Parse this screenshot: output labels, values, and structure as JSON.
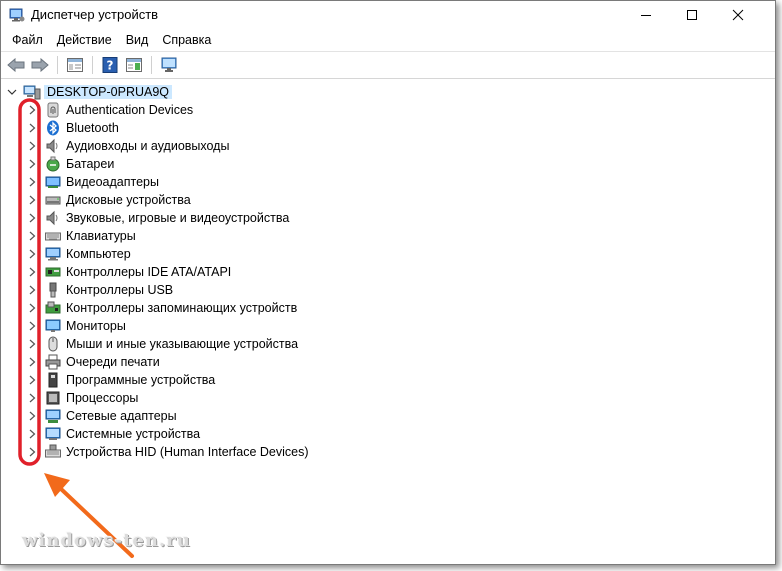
{
  "window": {
    "title": "Диспетчер устройств"
  },
  "menu": {
    "file": "Файл",
    "action": "Действие",
    "view": "Вид",
    "help": "Справка"
  },
  "tree": {
    "root": "DESKTOP-0PRUA9Q",
    "items": [
      {
        "label": "Authentication Devices",
        "icon": "fingerprint-icon"
      },
      {
        "label": "Bluetooth",
        "icon": "bluetooth-icon"
      },
      {
        "label": "Аудиовходы и аудиовыходы",
        "icon": "speaker-icon"
      },
      {
        "label": "Батареи",
        "icon": "battery-icon"
      },
      {
        "label": "Видеоадаптеры",
        "icon": "display-adapter-icon"
      },
      {
        "label": "Дисковые устройства",
        "icon": "disk-drive-icon"
      },
      {
        "label": "Звуковые, игровые и видеоустройства",
        "icon": "speaker-icon"
      },
      {
        "label": "Клавиатуры",
        "icon": "keyboard-icon"
      },
      {
        "label": "Компьютер",
        "icon": "computer-icon"
      },
      {
        "label": "Контроллеры IDE ATA/ATAPI",
        "icon": "ide-controller-icon"
      },
      {
        "label": "Контроллеры USB",
        "icon": "usb-icon"
      },
      {
        "label": "Контроллеры запоминающих устройств",
        "icon": "storage-controller-icon"
      },
      {
        "label": "Мониторы",
        "icon": "monitor-icon"
      },
      {
        "label": "Мыши и иные указывающие устройства",
        "icon": "mouse-icon"
      },
      {
        "label": "Очереди печати",
        "icon": "printer-icon"
      },
      {
        "label": "Программные устройства",
        "icon": "software-device-icon"
      },
      {
        "label": "Процессоры",
        "icon": "processor-icon"
      },
      {
        "label": "Сетевые адаптеры",
        "icon": "network-adapter-icon"
      },
      {
        "label": "Системные устройства",
        "icon": "system-devices-icon"
      },
      {
        "label": "Устройства HID (Human Interface Devices)",
        "icon": "hid-icon"
      }
    ]
  },
  "watermark": "windows-ten.ru",
  "colors": {
    "annotation": "#e0202a",
    "arrow": "#f26a1b",
    "selection": "#cce8ff"
  }
}
